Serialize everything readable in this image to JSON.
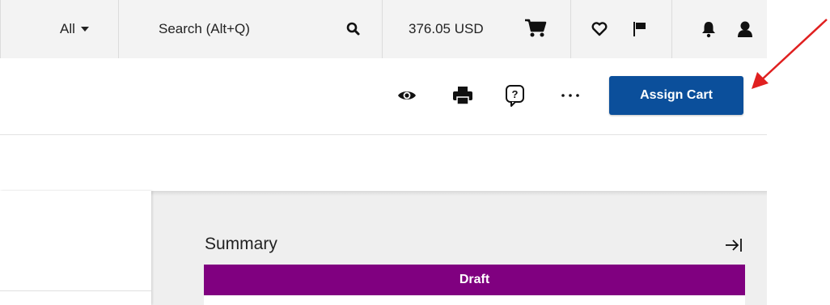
{
  "topbar": {
    "scope_label": "All",
    "search_placeholder": "Search (Alt+Q)",
    "cart_total": "376.05 USD"
  },
  "toolbar": {
    "assign_cart_label": "Assign Cart"
  },
  "summary": {
    "title": "Summary",
    "status": "Draft"
  },
  "colors": {
    "primary_button": "#0b4f9b",
    "status_draft": "#800080",
    "annotation_arrow": "#e02020"
  },
  "icons": [
    "caret-down-icon",
    "search-icon",
    "cart-icon",
    "heart-icon",
    "flag-icon",
    "bell-icon",
    "user-icon",
    "eye-icon",
    "print-icon",
    "help-bubble-icon",
    "more-icon",
    "collapse-right-icon",
    "annotation-arrow"
  ]
}
